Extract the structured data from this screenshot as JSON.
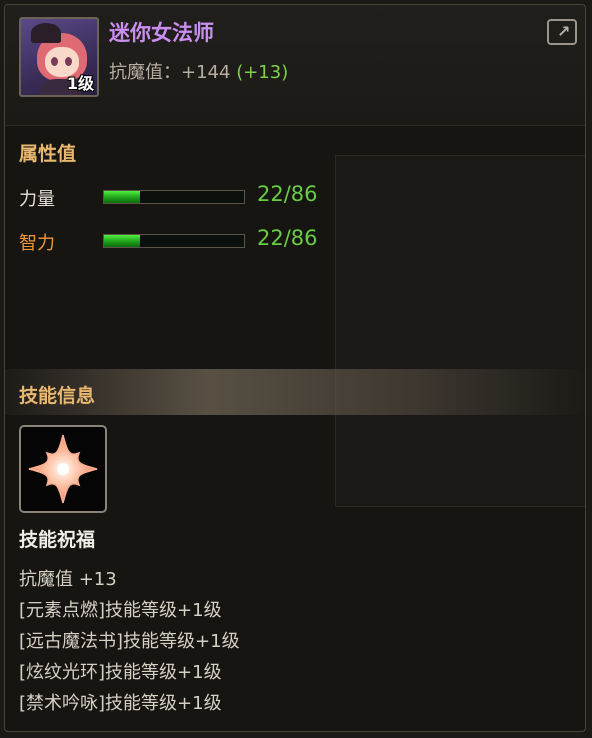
{
  "item": {
    "name": "迷你女法师",
    "level_badge": "1级",
    "resist_label": "抗魔值：+144",
    "resist_bonus": "(+13)"
  },
  "attributes": {
    "title": "属性值",
    "stats": [
      {
        "label": "力量",
        "value_text": "22/86",
        "current": 22,
        "max": 86,
        "label_color": "#e6e0d6"
      },
      {
        "label": "智力",
        "value_text": "22/86",
        "current": 22,
        "max": 86,
        "label_color": "#f0963a"
      }
    ]
  },
  "skill": {
    "section_title": "技能信息",
    "name": "技能祝福",
    "lines": [
      "抗魔值 +13",
      "[元素点燃]技能等级+1级",
      "[远古魔法书]技能等级+1级",
      "[炫纹光环]技能等级+1级",
      "[禁术吟咏]技能等级+1级"
    ]
  },
  "icons": {
    "share": "share-export-icon",
    "skill": "four-point-star-icon"
  },
  "colors": {
    "name": "#c98ef0",
    "section": "#e8b870",
    "bonus": "#7ed04a",
    "bar_fill": "#2fd02a"
  }
}
